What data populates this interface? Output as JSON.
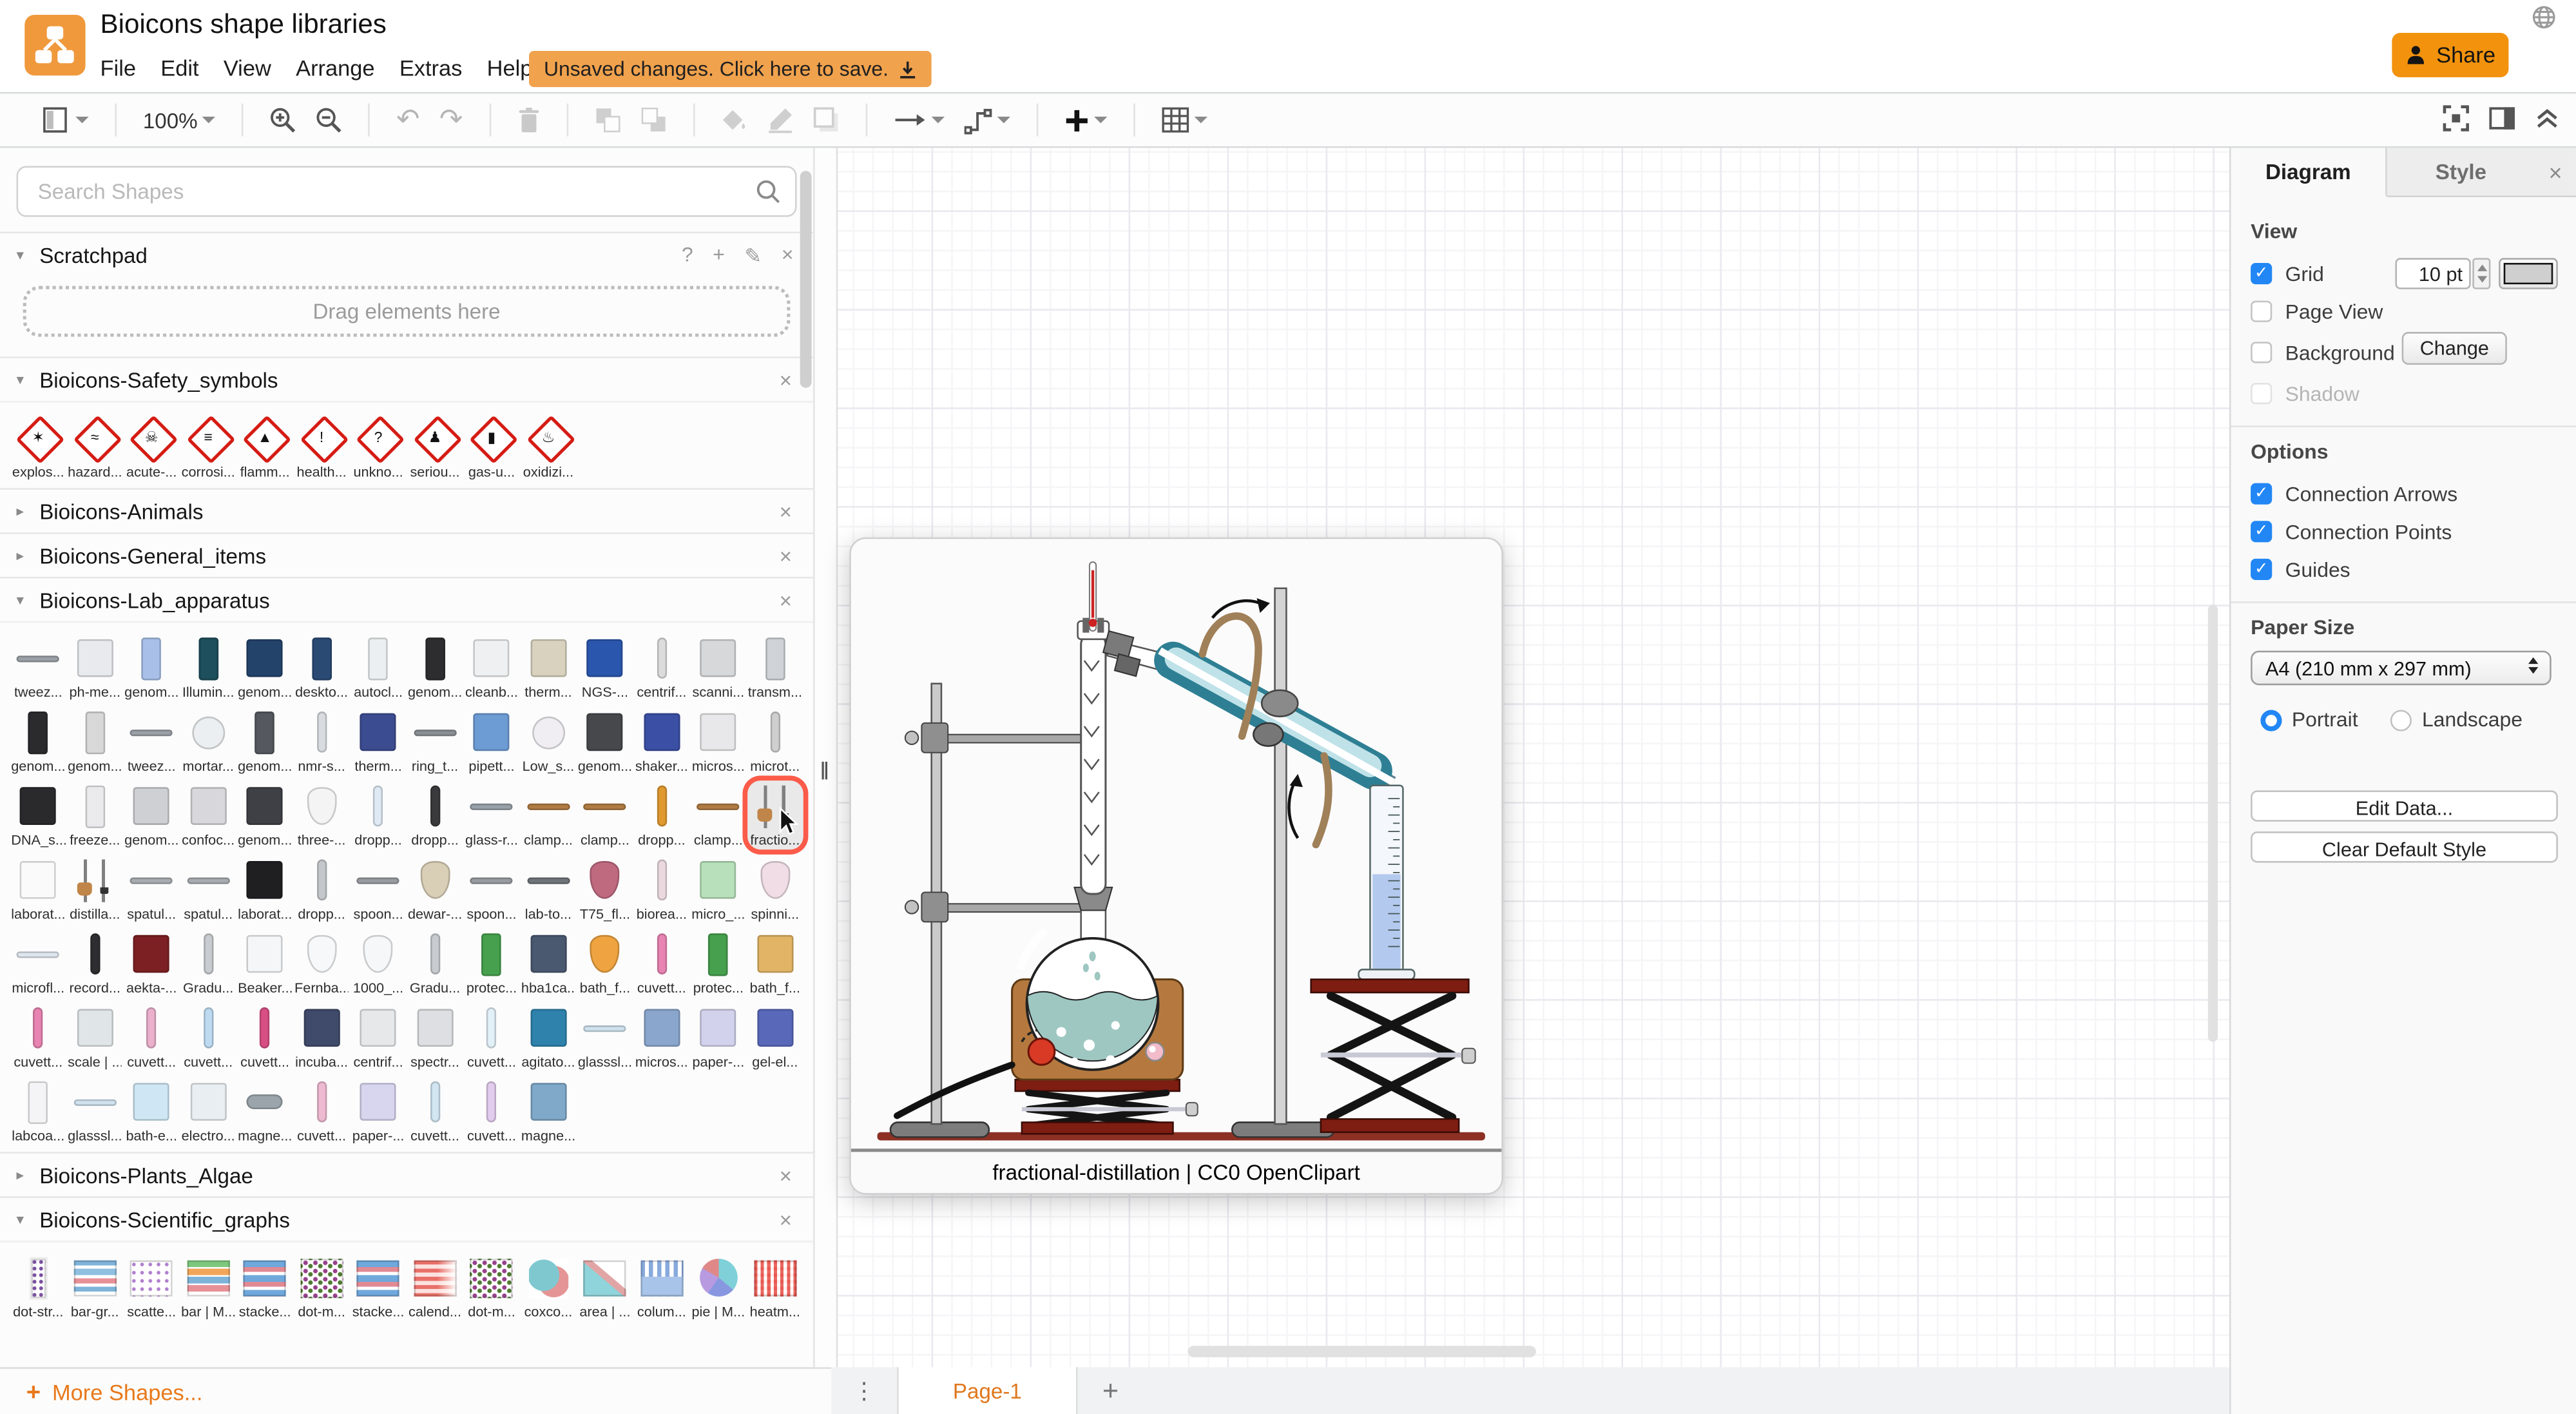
{
  "header": {
    "title": "Bioicons shape libraries",
    "menus": [
      "File",
      "Edit",
      "View",
      "Arrange",
      "Extras",
      "Help"
    ],
    "unsaved": "Unsaved changes. Click here to save.",
    "share": "Share"
  },
  "toolbar": {
    "zoom": "100%"
  },
  "sidebar": {
    "search_placeholder": "Search Shapes",
    "scratchpad": {
      "title": "Scratchpad",
      "hint": "Drag elements here",
      "tools": [
        "?",
        "+",
        "✎",
        "×"
      ]
    },
    "more_shapes": "More Shapes...",
    "sections": [
      {
        "title": "Bioicons-Safety_symbols",
        "collapsed": false,
        "shapes": [
          {
            "l": "explos...",
            "n": "explosive-symbol",
            "t": "diamond",
            "g": "✶"
          },
          {
            "l": "hazard...",
            "n": "environmental-hazard-symbol",
            "t": "diamond",
            "g": "≈"
          },
          {
            "l": "acute-...",
            "n": "acute-toxicity-symbol",
            "t": "diamond",
            "g": "☠"
          },
          {
            "l": "corrosi...",
            "n": "corrosive-symbol",
            "t": "diamond",
            "g": "≡"
          },
          {
            "l": "flamm...",
            "n": "flammable-symbol",
            "t": "diamond",
            "g": "▲"
          },
          {
            "l": "health...",
            "n": "health-hazard-symbol",
            "t": "diamond",
            "g": "!"
          },
          {
            "l": "unkno...",
            "n": "unknown-hazard-symbol",
            "t": "diamond",
            "g": "?"
          },
          {
            "l": "seriou...",
            "n": "serious-health-hazard-symbol",
            "t": "diamond",
            "g": "♟"
          },
          {
            "l": "gas-u...",
            "n": "gas-under-pressure-symbol",
            "t": "diamond",
            "g": "▮"
          },
          {
            "l": "oxidizi...",
            "n": "oxidizing-symbol",
            "t": "diamond",
            "g": "♨"
          }
        ]
      },
      {
        "title": "Bioicons-Animals",
        "collapsed": true
      },
      {
        "title": "Bioicons-General_items",
        "collapsed": true
      },
      {
        "title": "Bioicons-Lab_apparatus",
        "collapsed": false,
        "shapes": [
          {
            "l": "tweez...",
            "n": "tweezers",
            "t": "flat",
            "c": "#9aa0a6"
          },
          {
            "l": "ph-me...",
            "n": "ph-meter",
            "t": "box",
            "c": "#e8eaed"
          },
          {
            "l": "genom...",
            "n": "genomics-machine",
            "t": "tall",
            "c": "#a8c0e8"
          },
          {
            "l": "Illumin...",
            "n": "illumina-sequencer",
            "t": "tall",
            "c": "#1d4f5c"
          },
          {
            "l": "genom...",
            "n": "genomics-machine",
            "t": "box",
            "c": "#24436b"
          },
          {
            "l": "deskto...",
            "n": "desktop-sequencer",
            "t": "tall",
            "c": "#2a4a74"
          },
          {
            "l": "autocl...",
            "n": "autoclave",
            "t": "tall",
            "c": "#eceff1"
          },
          {
            "l": "genom...",
            "n": "genomics-machine",
            "t": "tall",
            "c": "#2d2d30"
          },
          {
            "l": "cleanb...",
            "n": "cleanbench",
            "t": "box",
            "c": "#eef0f2"
          },
          {
            "l": "therm...",
            "n": "thermocycler",
            "t": "box",
            "c": "#d8d2bf"
          },
          {
            "l": "NGS-...",
            "n": "ngs-sequencer",
            "t": "box",
            "c": "#2a56ad"
          },
          {
            "l": "centrif...",
            "n": "centrifuge-column",
            "t": "tube",
            "c": "#dcdcdc"
          },
          {
            "l": "scanni...",
            "n": "scanning-microscope",
            "t": "box",
            "c": "#d6d8da"
          },
          {
            "l": "transm...",
            "n": "transmission-microscope",
            "t": "tall",
            "c": "#cfd2d6"
          },
          {
            "l": "genom...",
            "n": "genomics-machine",
            "t": "tall",
            "c": "#2b2b2e"
          },
          {
            "l": "genom...",
            "n": "genomics-machine",
            "t": "tall",
            "c": "#d8d8d8"
          },
          {
            "l": "tweez...",
            "n": "tweezers",
            "t": "flat",
            "c": "#9aa0a6"
          },
          {
            "l": "mortar...",
            "n": "mortar-pestle",
            "t": "round",
            "c": "#eceff1"
          },
          {
            "l": "genom...",
            "n": "genomics-machine",
            "t": "tall",
            "c": "#55585e"
          },
          {
            "l": "nmr-s...",
            "n": "nmr-spectrometer",
            "t": "tube",
            "c": "#d8dce0"
          },
          {
            "l": "therm...",
            "n": "thermal-cycler",
            "t": "box",
            "c": "#3c4c90"
          },
          {
            "l": "ring_t...",
            "n": "ring-tool",
            "t": "flat",
            "c": "#8a8f94"
          },
          {
            "l": "pipett...",
            "n": "pipette-tips",
            "t": "box",
            "c": "#6d9bd4"
          },
          {
            "l": "Low_s...",
            "n": "low-storage-jar",
            "t": "round",
            "c": "#f0eef2"
          },
          {
            "l": "genom...",
            "n": "genomics-machine",
            "t": "box",
            "c": "#47484c"
          },
          {
            "l": "shaker...",
            "n": "shaker",
            "t": "box",
            "c": "#3b4fa4"
          },
          {
            "l": "micros...",
            "n": "microscope",
            "t": "box",
            "c": "#e8e8ea"
          },
          {
            "l": "microt...",
            "n": "microtube",
            "t": "tube",
            "c": "#cfcfcf"
          },
          {
            "l": "DNA_s...",
            "n": "dna-sequencer",
            "t": "box",
            "c": "#2a2a2c"
          },
          {
            "l": "freeze...",
            "n": "freezer",
            "t": "tall",
            "c": "#eaeaec"
          },
          {
            "l": "genom...",
            "n": "genomics-machine",
            "t": "box",
            "c": "#cfd0d4"
          },
          {
            "l": "confoc...",
            "n": "confocal-microscope",
            "t": "box",
            "c": "#d8d8dc"
          },
          {
            "l": "genom...",
            "n": "genomics-machine",
            "t": "box",
            "c": "#3f4046"
          },
          {
            "l": "three-...",
            "n": "three-neck-flask",
            "t": "flask",
            "c": "#f4f4f4"
          },
          {
            "l": "dropp...",
            "n": "dropper-bottles",
            "t": "tube",
            "c": "#dfe9f4"
          },
          {
            "l": "dropp...",
            "n": "dropper",
            "t": "tube",
            "c": "#3a3a3c"
          },
          {
            "l": "glass-r...",
            "n": "glass-rod",
            "t": "flat",
            "c": "#98a0a8"
          },
          {
            "l": "clamp...",
            "n": "clamp",
            "t": "flat",
            "c": "#b07c44"
          },
          {
            "l": "clamp...",
            "n": "clamp",
            "t": "flat",
            "c": "#b07c44"
          },
          {
            "l": "dropp...",
            "n": "dropper",
            "t": "tube",
            "c": "#e09a30"
          },
          {
            "l": "clamp...",
            "n": "clamp",
            "t": "flat",
            "c": "#b07c44"
          },
          {
            "l": "fractio...",
            "n": "fractional-distillation",
            "t": "stand",
            "sel": true
          },
          {
            "l": "laborat...",
            "n": "laboratory-sketch",
            "t": "box",
            "c": "#fafafa"
          },
          {
            "l": "distilla...",
            "n": "distillation-setup",
            "t": "stand"
          },
          {
            "l": "spatul...",
            "n": "spatula",
            "t": "flat",
            "c": "#a8acb0"
          },
          {
            "l": "spatul...",
            "n": "spatula",
            "t": "flat",
            "c": "#a8acb0"
          },
          {
            "l": "laborat...",
            "n": "laboratory-jack",
            "t": "box",
            "c": "#1f1f22"
          },
          {
            "l": "dropp...",
            "n": "dropper",
            "t": "tube",
            "c": "#c4c8cc"
          },
          {
            "l": "spoon...",
            "n": "spoon",
            "t": "flat",
            "c": "#989ca0"
          },
          {
            "l": "dewar-...",
            "n": "dewar-flask",
            "t": "flask",
            "c": "#d9cfb6"
          },
          {
            "l": "spoon...",
            "n": "spoon",
            "t": "flat",
            "c": "#989ca0"
          },
          {
            "l": "lab-to...",
            "n": "lab-tongs",
            "t": "flat",
            "c": "#70757a"
          },
          {
            "l": "T75_fl...",
            "n": "t75-flask",
            "t": "flask",
            "c": "#c06a80"
          },
          {
            "l": "biorea...",
            "n": "bioreactor",
            "t": "tube",
            "c": "#ead9de"
          },
          {
            "l": "micro_...",
            "n": "micro-slide",
            "t": "box",
            "c": "#b8e0ba"
          },
          {
            "l": "spinni...",
            "n": "spinner-flask",
            "t": "flask",
            "c": "#f0dde6"
          },
          {
            "l": "microfl...",
            "n": "microfluidic-chip",
            "t": "flat",
            "c": "#dfe6ee"
          },
          {
            "l": "record...",
            "n": "recording-electrode",
            "t": "tube",
            "c": "#2e2e30"
          },
          {
            "l": "aekta-...",
            "n": "aekta-purifier",
            "t": "box",
            "c": "#7c2024"
          },
          {
            "l": "Gradu...",
            "n": "graduated-cylinder",
            "t": "tube",
            "c": "#c8ccd0"
          },
          {
            "l": "Beaker...",
            "n": "beakers",
            "t": "box",
            "c": "#f4f6f8"
          },
          {
            "l": "Fernba...",
            "n": "fernbach-flask",
            "t": "flask",
            "c": "#f7f8f9"
          },
          {
            "l": "1000_...",
            "n": "erlenmeyer-flask-1000",
            "t": "flask",
            "c": "#f6f7f8"
          },
          {
            "l": "Gradu...",
            "n": "graduated-pipette",
            "t": "tube",
            "c": "#c8ccd0"
          },
          {
            "l": "protec...",
            "n": "protective-gown",
            "t": "tall",
            "c": "#46a04e"
          },
          {
            "l": "hba1ca...",
            "n": "hba1c-analyzer",
            "t": "box",
            "c": "#4a5870"
          },
          {
            "l": "bath_f...",
            "n": "bath-flask",
            "t": "flask",
            "c": "#efa441"
          },
          {
            "l": "cuvett...",
            "n": "cuvette",
            "t": "tube",
            "c": "#e884b2"
          },
          {
            "l": "protec...",
            "n": "protective-gown",
            "t": "tall",
            "c": "#46a04e"
          },
          {
            "l": "bath_f...",
            "n": "bath-flasks-rack",
            "t": "box",
            "c": "#e2b566"
          },
          {
            "l": "cuvett...",
            "n": "cuvette",
            "t": "tube",
            "c": "#e884b2"
          },
          {
            "l": "scale | ...",
            "n": "scale",
            "t": "box",
            "c": "#e0e6e8"
          },
          {
            "l": "cuvett...",
            "n": "cuvette",
            "t": "tube",
            "c": "#eab0cc"
          },
          {
            "l": "cuvett...",
            "n": "cuvette",
            "t": "tube",
            "c": "#bedaf0"
          },
          {
            "l": "cuvett...",
            "n": "cuvette",
            "t": "tube",
            "c": "#d84f84"
          },
          {
            "l": "incuba...",
            "n": "incubator",
            "t": "box",
            "c": "#404a6a"
          },
          {
            "l": "centrif...",
            "n": "centrifuge",
            "t": "box",
            "c": "#e6e8ea"
          },
          {
            "l": "spectr...",
            "n": "spectrometer",
            "t": "box",
            "c": "#dddfe2"
          },
          {
            "l": "cuvett...",
            "n": "cuvette",
            "t": "tube",
            "c": "#e2f0f8"
          },
          {
            "l": "agitato...",
            "n": "agitator",
            "t": "box",
            "c": "#2e82ac"
          },
          {
            "l": "glasssl...",
            "n": "glass-slide",
            "t": "flat",
            "c": "#cfe2ee"
          },
          {
            "l": "micros...",
            "n": "microscope",
            "t": "box",
            "c": "#8aa6cc"
          },
          {
            "l": "paper-...",
            "n": "paper-chamber",
            "t": "box",
            "c": "#d2d2ec"
          },
          {
            "l": "gel-el...",
            "n": "gel-electrophoresis",
            "t": "box",
            "c": "#5a68ba"
          },
          {
            "l": "labcoa...",
            "n": "labcoat",
            "t": "tall",
            "c": "#f4f4f6"
          },
          {
            "l": "glasssl...",
            "n": "glass-slide",
            "t": "flat",
            "c": "#cfe2ee"
          },
          {
            "l": "bath-e...",
            "n": "bath-equipment",
            "t": "box",
            "c": "#cfe7f4"
          },
          {
            "l": "electro...",
            "n": "electrophoresis-unit",
            "t": "box",
            "c": "#e9eef2"
          },
          {
            "l": "magne...",
            "n": "magnetic-stir-bar",
            "t": "pill",
            "c": "#9aa4aa"
          },
          {
            "l": "cuvett...",
            "n": "cuvette",
            "t": "tube",
            "c": "#eebad2"
          },
          {
            "l": "paper-...",
            "n": "paper-chamber",
            "t": "box",
            "c": "#d8d5ef"
          },
          {
            "l": "cuvett...",
            "n": "cuvette",
            "t": "tube",
            "c": "#d2e6f2"
          },
          {
            "l": "cuvett...",
            "n": "cuvette",
            "t": "tube",
            "c": "#e2ccee"
          },
          {
            "l": "magne...",
            "n": "magnetic-stirrer",
            "t": "box",
            "c": "#7fa8c9"
          }
        ]
      },
      {
        "title": "Bioicons-Plants_Algae",
        "collapsed": true
      },
      {
        "title": "Bioicons-Scientific_graphs",
        "collapsed": false,
        "shapes": [
          {
            "l": "dot-str...",
            "n": "dot-strip-chart",
            "t": "cdot"
          },
          {
            "l": "bar-gr...",
            "n": "bar-graph",
            "t": "chbar"
          },
          {
            "l": "scatte...",
            "n": "scatter-plot",
            "t": "cscat"
          },
          {
            "l": "bar | M...",
            "n": "bar-chart-multi",
            "t": "chbar2"
          },
          {
            "l": "stacke...",
            "n": "stacked-bar-chart",
            "t": "cstack"
          },
          {
            "l": "dot-m...",
            "n": "dot-matrix-chart",
            "t": "cdotm"
          },
          {
            "l": "stacke...",
            "n": "stacked-bar-chart",
            "t": "cstack"
          },
          {
            "l": "calend...",
            "n": "calendar-heatmap",
            "t": "ccal"
          },
          {
            "l": "dot-m...",
            "n": "dot-matrix-chart",
            "t": "cdotm"
          },
          {
            "l": "coxco...",
            "n": "coxcomb-chart",
            "t": "cpie2"
          },
          {
            "l": "area | ...",
            "n": "area-chart",
            "t": "carea"
          },
          {
            "l": "colum...",
            "n": "column-chart",
            "t": "ccol"
          },
          {
            "l": "pie | M...",
            "n": "pie-chart",
            "t": "cpie"
          },
          {
            "l": "heatm...",
            "n": "heatmap",
            "t": "cheat"
          }
        ]
      }
    ]
  },
  "canvas": {
    "caption": "fractional-distillation | CC0 OpenClipart"
  },
  "pages": {
    "current": "Page-1"
  },
  "panel": {
    "tabs": [
      "Diagram",
      "Style"
    ],
    "view": {
      "title": "View",
      "grid": "Grid",
      "grid_size": "10 pt",
      "page_view": "Page View",
      "background": "Background",
      "change": "Change",
      "shadow": "Shadow"
    },
    "options": {
      "title": "Options",
      "items": [
        "Connection Arrows",
        "Connection Points",
        "Guides"
      ]
    },
    "paper": {
      "title": "Paper Size",
      "value": "A4 (210 mm x 297 mm)",
      "portrait": "Portrait",
      "landscape": "Landscape"
    },
    "buttons": [
      "Edit Data...",
      "Clear Default Style"
    ]
  },
  "colors": {
    "accent_orange": "#f2920d",
    "unsaved_orange": "#f0a24d",
    "checkbox_blue": "#2287f5",
    "selection_red": "#fb5b49",
    "ground_maroon": "#8c3024"
  }
}
